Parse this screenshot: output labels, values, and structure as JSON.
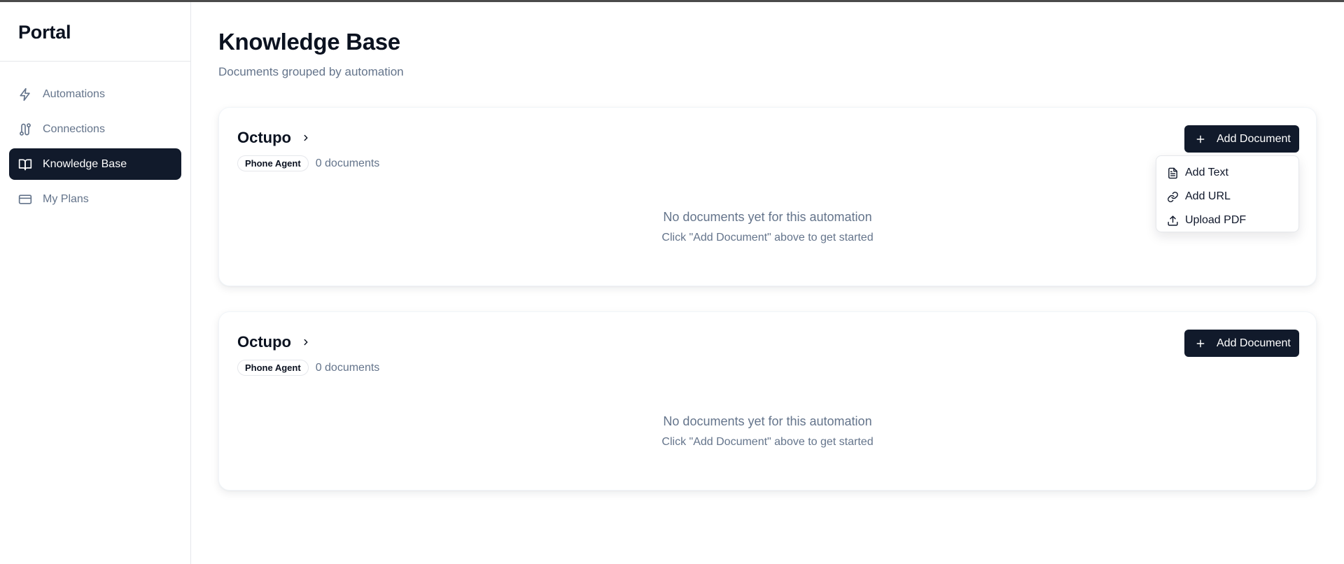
{
  "app": {
    "brand": "Portal"
  },
  "sidebar": {
    "items": [
      {
        "label": "Automations",
        "icon": "bolt-icon",
        "active": false
      },
      {
        "label": "Connections",
        "icon": "route-icon",
        "active": false
      },
      {
        "label": "Knowledge Base",
        "icon": "book-open-icon",
        "active": true
      },
      {
        "label": "My Plans",
        "icon": "credit-card-icon",
        "active": false
      }
    ]
  },
  "header": {
    "title": "Knowledge Base",
    "subtitle": "Documents grouped by automation"
  },
  "cards": [
    {
      "name": "Octupo",
      "badge": "Phone Agent",
      "doc_count": "0 documents",
      "button_label": "Add Document",
      "empty_title": "No documents yet for this automation",
      "empty_hint": "Click \"Add Document\" above to get started"
    },
    {
      "name": "Octupo",
      "badge": "Phone Agent",
      "doc_count": "0 documents",
      "button_label": "Add Document",
      "empty_title": "No documents yet for this automation",
      "empty_hint": "Click \"Add Document\" above to get started"
    }
  ],
  "dropdown": {
    "items": [
      {
        "label": "Add Text",
        "icon": "file-text-icon"
      },
      {
        "label": "Add URL",
        "icon": "link-icon"
      },
      {
        "label": "Upload PDF",
        "icon": "upload-icon"
      }
    ]
  },
  "colors": {
    "accent": "#111a2b",
    "muted": "#64748b",
    "border": "#e5e7eb"
  }
}
